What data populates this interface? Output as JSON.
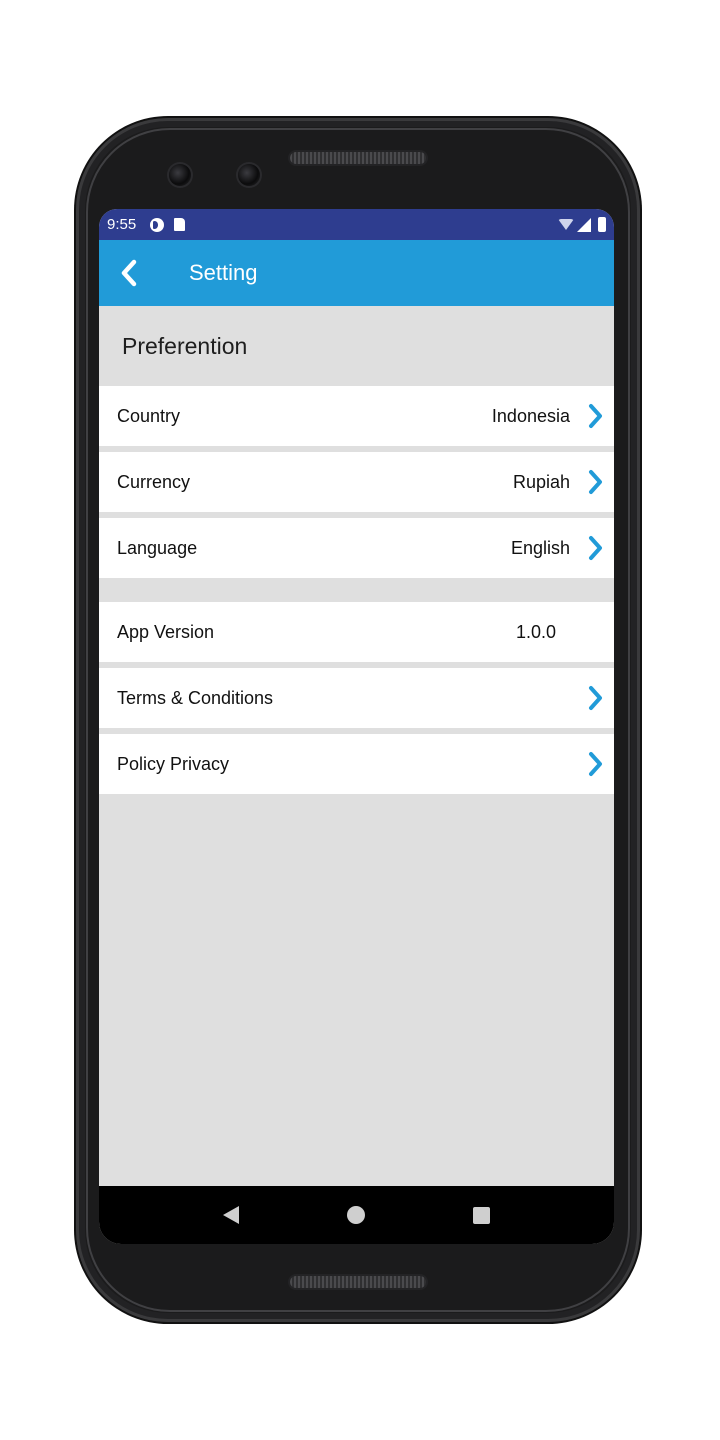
{
  "status_bar": {
    "time": "9:55"
  },
  "app_bar": {
    "title": "Setting"
  },
  "preference_section": {
    "header": "Preferention",
    "items": [
      {
        "label": "Country",
        "value": "Indonesia"
      },
      {
        "label": "Currency",
        "value": "Rupiah"
      },
      {
        "label": "Language",
        "value": "English"
      }
    ]
  },
  "about_section": {
    "app_version": {
      "label": "App Version",
      "value": "1.0.0"
    },
    "items": [
      {
        "label": "Terms & Conditions"
      },
      {
        "label": "Policy Privacy"
      }
    ]
  },
  "colors": {
    "status_bar": "#2e3d8f",
    "app_bar": "#219bd8",
    "chevron": "#219bd8",
    "background": "#dfdfdf"
  },
  "icons": {
    "back": "chevron-left-icon",
    "row_arrow": "chevron-right-icon",
    "nav_back": "triangle-back-icon",
    "nav_home": "circle-home-icon",
    "nav_recent": "square-recents-icon"
  }
}
